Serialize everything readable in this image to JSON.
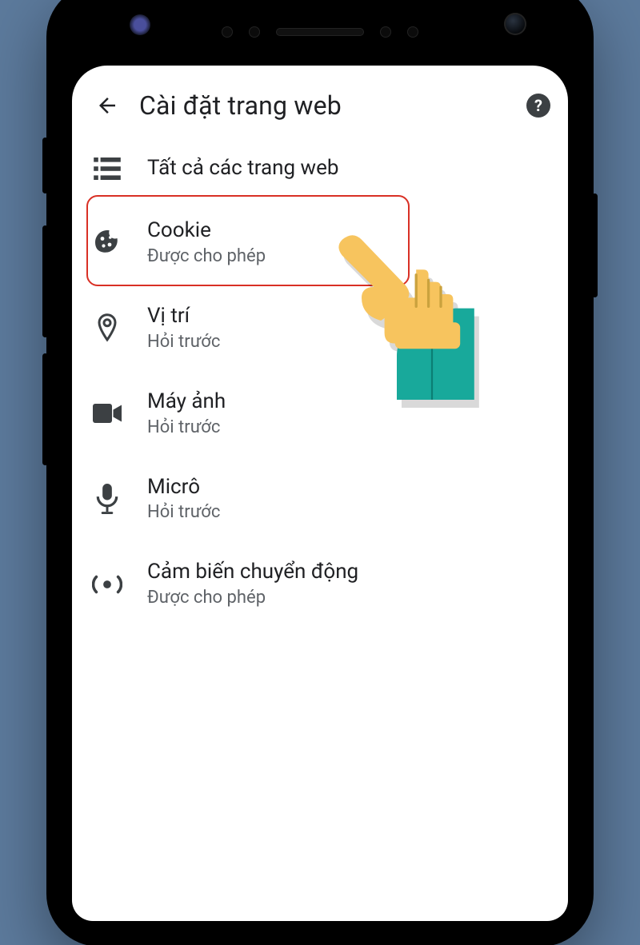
{
  "header": {
    "title": "Cài đặt trang web"
  },
  "rows": [
    {
      "icon": "list-icon",
      "label": "Tất cả các trang web",
      "sub": "",
      "noSub": true
    },
    {
      "icon": "cookie-icon",
      "label": "Cookie",
      "sub": "Được cho phép",
      "highlight": true
    },
    {
      "icon": "location-icon",
      "label": "Vị trí",
      "sub": "Hỏi trước"
    },
    {
      "icon": "camera-icon",
      "label": "Máy ảnh",
      "sub": "Hỏi trước"
    },
    {
      "icon": "mic-icon",
      "label": "Micrô",
      "sub": "Hỏi trước"
    },
    {
      "icon": "motion-icon",
      "label": "Cảm biến chuyển động",
      "sub": "Được cho phép"
    }
  ]
}
